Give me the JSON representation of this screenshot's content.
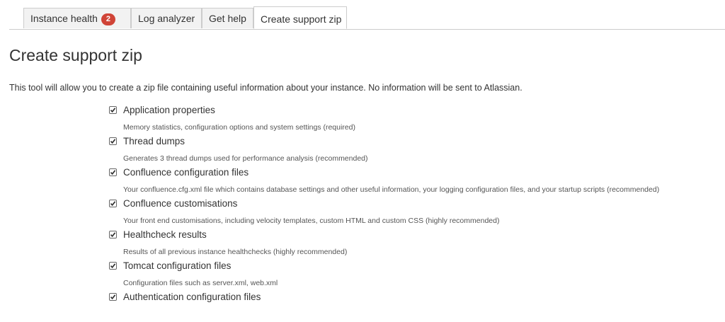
{
  "tabs": [
    {
      "label": "Instance health",
      "badge": "2"
    },
    {
      "label": "Log analyzer"
    },
    {
      "label": "Get help"
    },
    {
      "label": "Create support zip"
    }
  ],
  "active_tab": "Create support zip",
  "colors": {
    "badge": "#d04437",
    "border": "#cccccc",
    "tab_background": "#f2f2f2"
  },
  "page": {
    "title": "Create support zip",
    "intro": "This tool will allow you to create a zip file containing useful information about your instance. No information will be sent to Atlassian."
  },
  "options": [
    {
      "label": "Application properties",
      "description": "Memory statistics, configuration options and system settings (required)",
      "checked": true
    },
    {
      "label": "Thread dumps",
      "description": "Generates 3 thread dumps used for performance analysis (recommended)",
      "checked": true
    },
    {
      "label": "Confluence configuration files",
      "description": "Your confluence.cfg.xml file which contains database settings and other useful information, your logging configuration files, and your startup scripts (recommended)",
      "checked": true
    },
    {
      "label": "Confluence customisations",
      "description": "Your front end customisations, including velocity templates, custom HTML and custom CSS (highly recommended)",
      "checked": true
    },
    {
      "label": "Healthcheck results",
      "description": "Results of all previous instance healthchecks (highly recommended)",
      "checked": true
    },
    {
      "label": "Tomcat configuration files",
      "description": "Configuration files such as server.xml, web.xml",
      "checked": true
    },
    {
      "label": "Authentication configuration files",
      "checked": true
    }
  ]
}
